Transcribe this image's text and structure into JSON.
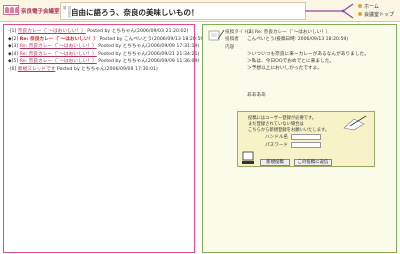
{
  "header": {
    "logo_text": "奈良電子会議室",
    "title_sub": "自由広場",
    "tagline": "自由に語ろう、奈良の美味しいもの！",
    "nav": [
      "ホーム",
      "会議室トップ"
    ],
    "colors": {
      "accent": "#b0365f",
      "header_bg": "#fbf5e4",
      "left_border": "#e04b86",
      "right_border": "#7fae57",
      "right_bg": "#fbfbea",
      "login_bg": "#f7f3c8"
    }
  },
  "tree": [
    {
      "prefix": "-[1] ",
      "link": "奈良カレー（ﾞ～はおいしい！）",
      "suffix": " Posted by とちちゃん(2006/09/03 21:20:02)",
      "current": false
    },
    {
      "prefix": "  ◆[2] ",
      "link": "Re: 奈良カレー（ﾞ～はおいしい！）",
      "suffix": " Posted by こんぺいとう(2006/09/13 18:20:59)",
      "current": true
    },
    {
      "prefix": "    ◆[3] ",
      "link": "Re: 奈良カレー（ﾞ～はおいしい！）",
      "suffix": " Posted by とちちゃん(2006/09/09 17:31:19)",
      "current": false
    },
    {
      "prefix": "      ◆[4] ",
      "link": "Re: 奈良カレー（ﾞ～はおいしい！）",
      "suffix": " Posted by とちちゃん(2006/09/21 21:34:21)",
      "current": false
    },
    {
      "prefix": "        ◆[5] ",
      "link": "Re: 奈良カレー（ﾞ～はおいしい！）",
      "suffix": " Posted by とちちゃん(2006/09/09 11:36:09)",
      "current": false
    },
    {
      "prefix": "-[6] ",
      "link": "新規スレッドです",
      "suffix": " Posted by とちちゃん(2006/09/09 17:30:01)",
      "current": false
    }
  ],
  "post": {
    "title_label": "投稿タイトル",
    "title_value": "[2] Re: 奈良カレー（ﾞ～はおいしい！）",
    "poster_label": "投稿者",
    "poster_value": "こんぺいとう(投稿日時: 2006/09/13 18:20:59)",
    "content_label": "内容",
    "body": [
      "＞いついつも奈良に来ーカレーがあるなんがありました。",
      "＞私は、今日OOでおめでとに来ました。",
      "＞予想以上においしかったですよ。"
    ],
    "signature": "ああああ"
  },
  "login": {
    "note": [
      "投稿にはユーザー登録が必要です。",
      "まだ登録されていない場合は",
      "こちらから新規登録をお願いいたします。"
    ],
    "handle_label": "ハンドル名",
    "password_label": "パスワード",
    "new_button": "新規投稿",
    "reply_button": "この投稿に返信"
  }
}
